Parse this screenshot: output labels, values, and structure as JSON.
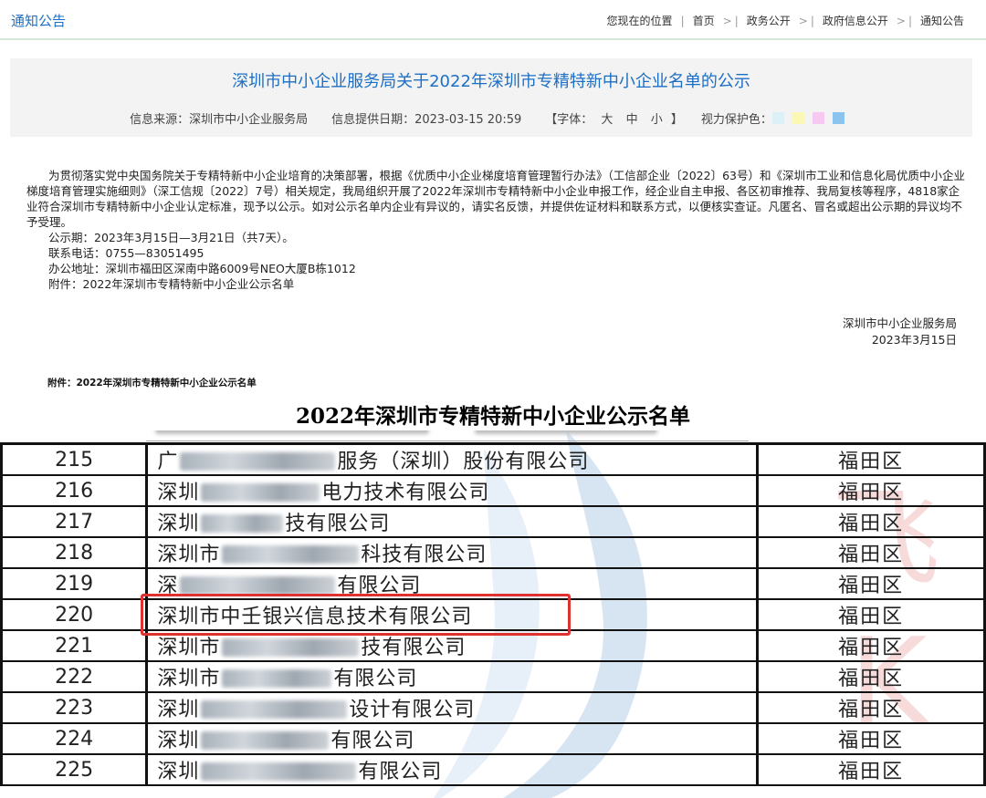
{
  "topbar": {
    "section_title": "通知公告",
    "location_label": "您现在的位置",
    "breadcrumb": [
      "首页",
      "政务公开",
      "政府信息公开",
      "通知公告"
    ],
    "separator": ">"
  },
  "article": {
    "title": "深圳市中小企业服务局关于2022年深圳市专精特新中小企业名单的公示",
    "source": "信息来源：深圳市中小企业服务局",
    "date": "信息提供日期：2023-03-15 20:59",
    "font_label_open": "【字体：",
    "font_sizes": [
      "大",
      "中",
      "小"
    ],
    "font_label_close": "】",
    "eye_protect_label": "视力保护色：",
    "eye_colors": [
      "#dcf0f8",
      "#fbf8b6",
      "#f7c8f2",
      "#8cc4f0"
    ],
    "paragraph": "为贯彻落实党中央国务院关于专精特新中小企业培育的决策部署，根据《优质中小企业梯度培育管理暂行办法》（工信部企业〔2022〕63号）和《深圳市工业和信息化局优质中小企业梯度培育管理实施细则》（深工信规〔2022〕7号）相关规定，我局组织开展了2022年深圳市专精特新中小企业申报工作，经企业自主申报、各区初审推荐、我局复核等程序，4818家企业符合深圳市专精特新中小企业认定标准，现予以公示。如对公示名单内企业有异议的，请实名反馈，并提供佐证材料和联系方式，以便核实查证。凡匿名、冒名或超出公示期的异议均不予受理。",
    "period": "公示期：2023年3月15日—3月21日（共7天）。",
    "phone": "联系电话：0755—83051495",
    "address": "办公地址：深圳市福田区深南中路6009号NEO大厦B栋1012",
    "attachment": "附件：2022年深圳市专精特新中小企业公示名单",
    "signoff_org": "深圳市中小企业服务局",
    "signoff_date": "2023年3月15日"
  },
  "list": {
    "attach_label": "附件：2022年深圳市专精特新中小企业公示名单",
    "title": "2022年深圳市专精特新中小企业公示名单",
    "rows": [
      {
        "num": "215",
        "prefix": "广",
        "blur": 170,
        "suffix": "服务（深圳）股份有限公司",
        "district": "福田区"
      },
      {
        "num": "216",
        "prefix": "深圳",
        "blur": 130,
        "suffix": "电力技术有限公司",
        "district": "福田区"
      },
      {
        "num": "217",
        "prefix": "深圳",
        "blur": 90,
        "suffix": "技有限公司",
        "district": "福田区"
      },
      {
        "num": "218",
        "prefix": "深圳市",
        "blur": 150,
        "suffix": "科技有限公司",
        "district": "福田区"
      },
      {
        "num": "219",
        "prefix": "深",
        "blur": 170,
        "suffix": "有限公司",
        "district": "福田区"
      },
      {
        "num": "220",
        "prefix": "深圳市中壬银兴信息技术有限公司",
        "blur": 0,
        "suffix": "",
        "district": "福田区"
      },
      {
        "num": "221",
        "prefix": "深圳市",
        "blur": 150,
        "suffix": "技有限公司",
        "district": "福田区"
      },
      {
        "num": "222",
        "prefix": "深圳市",
        "blur": 120,
        "suffix": "有限公司",
        "district": "福田区"
      },
      {
        "num": "223",
        "prefix": "深圳",
        "blur": 160,
        "suffix": "设计有限公司",
        "district": "福田区"
      },
      {
        "num": "224",
        "prefix": "深圳",
        "blur": 140,
        "suffix": "有限公司",
        "district": "福田区"
      },
      {
        "num": "225",
        "prefix": "深圳",
        "blur": 170,
        "suffix": "有限公司",
        "district": "福田区"
      }
    ],
    "highlight_color": "#e03131"
  }
}
